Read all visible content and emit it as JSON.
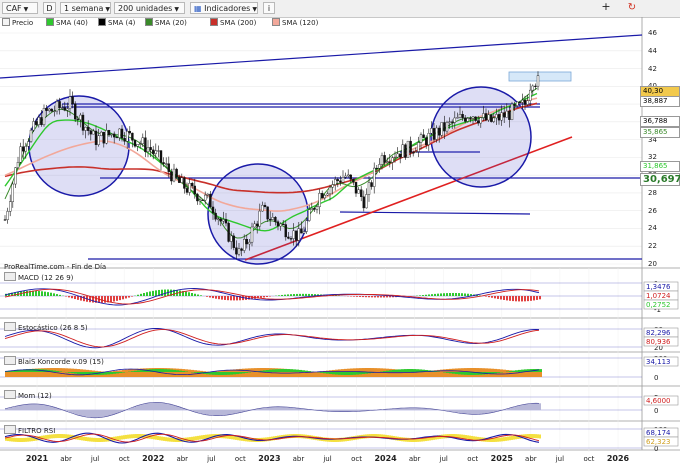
{
  "toolbar": {
    "ticker": "CAF",
    "period_code": "D",
    "period": "1 semana",
    "units": "200 unidades",
    "indicators": "Indicadores"
  },
  "legend": [
    {
      "label": "Precio",
      "color": "#f4f4f4"
    },
    {
      "label": "SMA (40)",
      "color": "#2ec82e"
    },
    {
      "label": "SMA (4)",
      "color": "#000000"
    },
    {
      "label": "SMA (20)",
      "color": "#3a8a2a"
    },
    {
      "label": "SMA (200)",
      "color": "#c8302a"
    },
    {
      "label": "SMA (120)",
      "color": "#f2a89a"
    }
  ],
  "price_panel": {
    "watermark": "ProRealTime.com - Fin de Día",
    "y_ticks": [
      "46",
      "44",
      "42",
      "40",
      "38",
      "36",
      "34",
      "32",
      "30",
      "28",
      "26",
      "24",
      "22",
      "20"
    ],
    "last_price": "40,30",
    "labels": [
      {
        "text": "40,30",
        "color": "#000000",
        "bg": "#f2c94c"
      },
      {
        "text": "38,887",
        "color": "#000000",
        "bg": "#ffffff"
      },
      {
        "text": "36,788",
        "color": "#000000",
        "bg": "#ffffff"
      },
      {
        "text": "35,865",
        "color": "#3a8a2a",
        "bg": "#ffffff"
      },
      {
        "text": "31,865",
        "color": "#2ec82e",
        "bg": "#ffffff"
      },
      {
        "text": "30,697",
        "color": "#2a7a2a",
        "bg": "#ffffff"
      }
    ]
  },
  "panels": [
    {
      "title": "MACD (12 26 9)",
      "ticks": [
        "1",
        "0",
        "-1"
      ],
      "labels": [
        "1,3476",
        "1,0724",
        "0,2752"
      ]
    },
    {
      "title": "Estocástico (26 8 5)",
      "ticks": [
        "80",
        "20"
      ],
      "labels": [
        "82,296",
        "80,936"
      ]
    },
    {
      "title": "BlaiS Koncorde v.09 (15)",
      "ticks": [
        "200",
        "0"
      ],
      "labels": [
        "34,113"
      ]
    },
    {
      "title": "Mom (12)",
      "ticks": [
        "5",
        "0"
      ],
      "labels": [
        "4,6000"
      ]
    },
    {
      "title": "FILTRO RSI",
      "ticks": [
        "100",
        "0"
      ],
      "labels": [
        "68,174",
        "62,323"
      ]
    }
  ],
  "x_axis": [
    "2021",
    "abr",
    "jul",
    "oct",
    "2022",
    "abr",
    "jul",
    "oct",
    "2023",
    "abr",
    "jul",
    "oct",
    "2024",
    "abr",
    "jul",
    "oct",
    "2025",
    "abr",
    "jul",
    "oct",
    "2026"
  ],
  "colors": {
    "accent": "#1a1aa8",
    "trend": "#e02020",
    "circle": "#1a1aa8"
  }
}
